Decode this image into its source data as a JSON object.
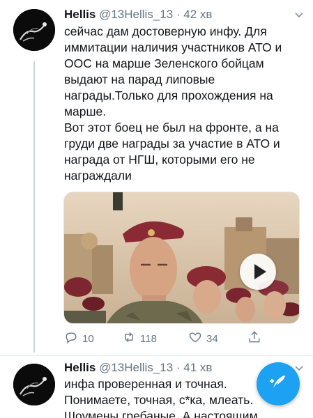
{
  "colors": {
    "accent": "#1da1f2",
    "text_primary": "#14171a",
    "text_secondary": "#657786",
    "thread_line": "#ccd6dd"
  },
  "tweets": [
    {
      "author_name": "Hellis",
      "handle": "@13Hellis_13",
      "separator": " · ",
      "time": "42 хв",
      "paragraphs": [
        "сейчас дам достоверную инфу. Для иммитации наличия участников АТО и ООС на марше Зеленского бойцам выдают на парад липовые награды.Только для прохождения на марше.",
        "Вот этот боец не был на фронте, а на груди две награды за участие в АТО и награда от НГШ, которыми его не награждали"
      ],
      "media": {
        "type": "video",
        "icon": "play-icon"
      },
      "actions": {
        "reply_count": "10",
        "retweet_count": "118",
        "like_count": "34",
        "icons": [
          "reply-icon",
          "retweet-icon",
          "like-icon",
          "share-icon"
        ]
      }
    },
    {
      "author_name": "Hellis",
      "handle": "@13Hellis_13",
      "separator": " · ",
      "time": "41 хв",
      "paragraphs": [
        "инфа проверенная и точная.",
        "Понимаете, точная, с*ка, млеать.",
        "Шоумены гребаные. А настоящим"
      ]
    }
  ],
  "compose_button": {
    "icon": "compose-tweet-icon"
  }
}
